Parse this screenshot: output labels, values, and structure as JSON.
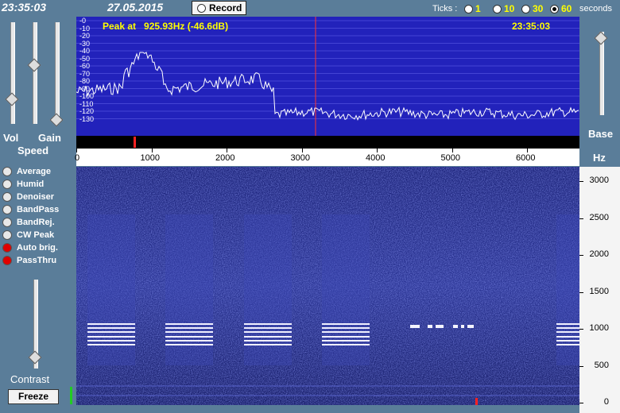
{
  "top": {
    "time": "23:35:03",
    "date": "27.05.2015",
    "record_label": "Record",
    "ticks_label": "Ticks :",
    "tick_options": [
      "1",
      "10",
      "30",
      "60"
    ],
    "tick_selected": "60",
    "seconds_label": "seconds"
  },
  "left": {
    "vol_label": "Vol",
    "gain_label": "Gain",
    "speed_label": "Speed",
    "toggles": [
      {
        "label": "Average",
        "on": false
      },
      {
        "label": "Humid",
        "on": false
      },
      {
        "label": "Denoiser",
        "on": false
      },
      {
        "label": "BandPass",
        "on": false
      },
      {
        "label": "BandRej.",
        "on": false
      },
      {
        "label": "CW Peak",
        "on": false
      },
      {
        "label": "Auto brig.",
        "on": true
      },
      {
        "label": "PassThru",
        "on": true
      }
    ],
    "contrast_label": "Contrast",
    "freeze_label": "Freeze"
  },
  "right": {
    "base_label": "Base",
    "hz_label": "Hz"
  },
  "spectrum": {
    "peak_text": "Peak at   925.93Hz (-46.6dB)",
    "time": "23:35:03",
    "db_ticks": [
      "-0",
      "-10",
      "-20",
      "-30",
      "-40",
      "-50",
      "-60",
      "-70",
      "-80",
      "-90",
      "-100",
      "-110",
      "-120",
      "-130"
    ],
    "freq_ticks": [
      "0",
      "1000",
      "2000",
      "3000",
      "4000",
      "5000",
      "6000"
    ],
    "colors": {
      "bg": "#2222bb",
      "trace": "#ffffff",
      "grid": "#6666ee",
      "cursor": "#ff3333",
      "text": "#ffff00"
    }
  },
  "waterfall": {
    "hz_ticks": [
      "3000",
      "2500",
      "2000",
      "1500",
      "1000",
      "500",
      "0"
    ]
  }
}
